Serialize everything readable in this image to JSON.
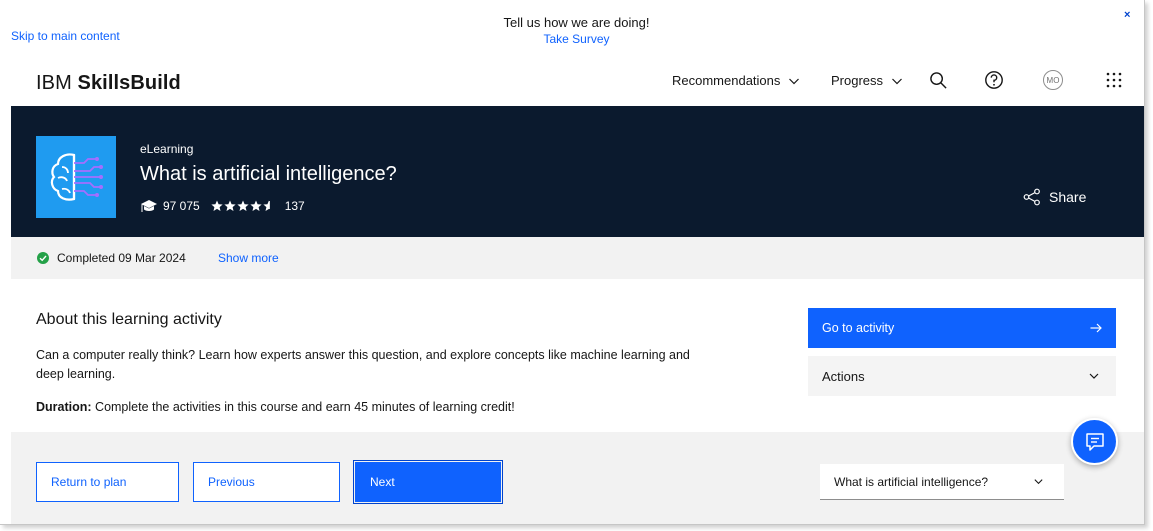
{
  "survey": {
    "skip_link": "Skip to main content",
    "message": "Tell us how we are doing!",
    "link": "Take Survey",
    "close": "×"
  },
  "header": {
    "logo_prefix": "IBM ",
    "logo_bold": "SkillsBuild",
    "nav": [
      {
        "label": "Recommendations"
      },
      {
        "label": "Progress"
      }
    ],
    "avatar_initials": "MO"
  },
  "hero": {
    "kind": "eLearning",
    "title": "What is artificial intelligence?",
    "learners": "97 075",
    "rating": 4.5,
    "rating_count": "137",
    "share_label": "Share"
  },
  "status": {
    "completed": "Completed 09 Mar 2024",
    "show_more": "Show more",
    "colors": {
      "complete": "#24a148"
    }
  },
  "about": {
    "title": "About this learning activity",
    "description": "Can a computer really think? Learn how experts answer this question, and explore concepts like machine learning and deep learning.",
    "duration_label": "Duration:",
    "duration_text": " Complete the activities in this course and earn 45 minutes of learning credit!"
  },
  "sidebar": {
    "go_label": "Go to activity",
    "actions_label": "Actions"
  },
  "footer": {
    "return_label": "Return to plan",
    "previous_label": "Previous",
    "next_label": "Next",
    "select_value": "What is artificial intelligence?"
  },
  "theme": {
    "accent": "#0f62fe",
    "hero_bg": "#0b1a2e",
    "thumb_bg": "#1f9bf0"
  },
  "icons": [
    "chevron-down-icon",
    "search-icon",
    "help-icon",
    "app-switcher-icon",
    "graduation-cap-icon",
    "star-icon",
    "share-icon",
    "checkmark-icon",
    "arrow-right-icon",
    "chat-icon"
  ]
}
